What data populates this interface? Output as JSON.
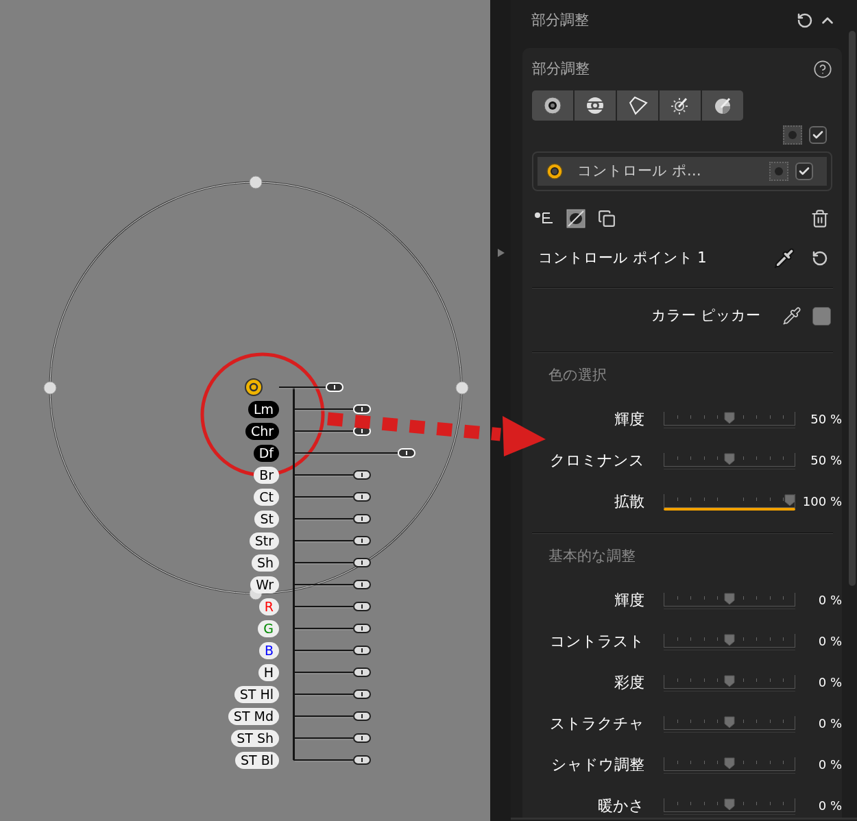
{
  "canvas": {
    "control_point": {
      "adjustments": [
        {
          "label": "Lm",
          "active": true
        },
        {
          "label": "Chr",
          "active": true
        },
        {
          "label": "Df",
          "active": true
        },
        {
          "label": "Br",
          "active": false
        },
        {
          "label": "Ct",
          "active": false
        },
        {
          "label": "St",
          "active": false
        },
        {
          "label": "Str",
          "active": false
        },
        {
          "label": "Sh",
          "active": false
        },
        {
          "label": "Wr",
          "active": false
        },
        {
          "label": "R",
          "active": false,
          "color": "#ff0000"
        },
        {
          "label": "G",
          "active": false,
          "color": "#008800"
        },
        {
          "label": "B",
          "active": false,
          "color": "#0000ff"
        },
        {
          "label": "H",
          "active": false
        },
        {
          "label": "ST Hl",
          "active": false
        },
        {
          "label": "ST Md",
          "active": false
        },
        {
          "label": "ST Sh",
          "active": false
        },
        {
          "label": "ST Bl",
          "active": false
        }
      ]
    }
  },
  "panel": {
    "title": "部分調整",
    "card": {
      "title": "部分調整",
      "mask_checked": true,
      "points": [
        {
          "name": "コントロール ポ…",
          "selected": true,
          "checked": true
        }
      ],
      "point_name": "コントロール ポイント 1",
      "color_picker": "カラー ピッカー",
      "sections": [
        {
          "title": "色の選択",
          "sliders": [
            {
              "label": "輝度",
              "level": 0.5,
              "reading": "50 %",
              "highlighted": false
            },
            {
              "label": "クロミナンス",
              "level": 0.5,
              "reading": "50 %",
              "highlighted": false
            },
            {
              "label": "拡散",
              "level": 1,
              "reading": "100 %",
              "highlighted": true
            }
          ]
        },
        {
          "title": "基本的な調整",
          "sliders": [
            {
              "label": "輝度",
              "level": 0.5,
              "reading": "0 %",
              "highlighted": false
            },
            {
              "label": "コントラスト",
              "level": 0.5,
              "reading": "0 %",
              "highlighted": false
            },
            {
              "label": "彩度",
              "level": 0.5,
              "reading": "0 %",
              "highlighted": false
            },
            {
              "label": "ストラクチャ",
              "level": 0.5,
              "reading": "0 %",
              "highlighted": false
            },
            {
              "label": "シャドウ調整",
              "level": 0.5,
              "reading": "0 %",
              "highlighted": false
            },
            {
              "label": "暖かさ",
              "level": 0.5,
              "reading": "0 %",
              "highlighted": false
            }
          ]
        }
      ]
    }
  }
}
